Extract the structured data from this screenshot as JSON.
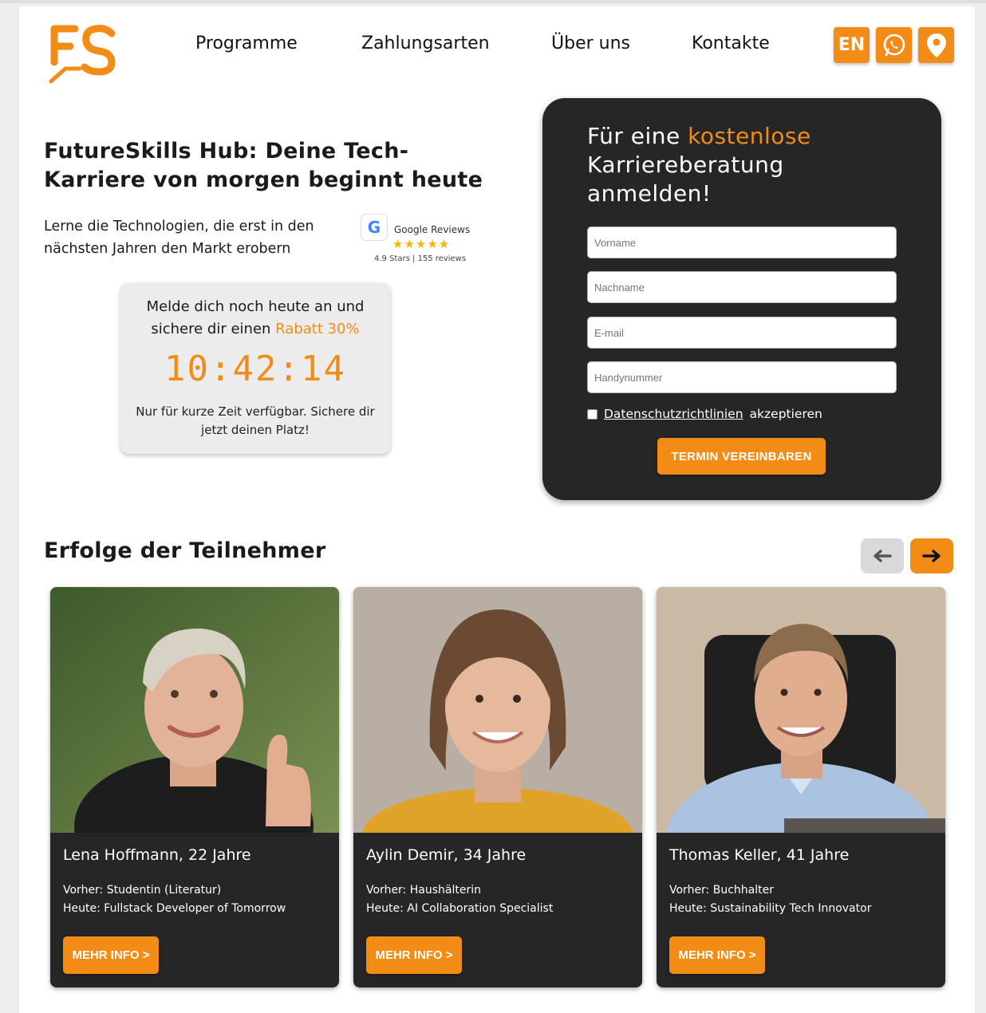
{
  "brand": {
    "logo_text": "FS",
    "accent": "#f28c16"
  },
  "nav": {
    "items": [
      {
        "label": "Programme"
      },
      {
        "label": "Zahlungsarten"
      },
      {
        "label": "Über uns"
      },
      {
        "label": "Kontakte"
      }
    ]
  },
  "header_buttons": {
    "language": "EN",
    "whatsapp_icon": "whatsapp-icon",
    "location_icon": "location-pin-icon"
  },
  "hero": {
    "title": "FutureSkills Hub: Deine Tech-Karriere von morgen beginnt heute",
    "subtitle": "Lerne die Technologien, die erst in den nächsten Jahren den Markt erobern"
  },
  "google_reviews": {
    "title": "Google Reviews",
    "stars": "★★★★★",
    "meta": "4.9 Stars | 155 reviews",
    "rating": 4.9
  },
  "promo": {
    "line1": "Melde dich noch heute an und",
    "line2_prefix": "sichere dir einen ",
    "line2_accent": "Rabatt 30%",
    "timer": "10:42:14",
    "note": "Nur für kurze Zeit verfügbar. Sichere dir jetzt deinen Platz!"
  },
  "form": {
    "title_prefix": "Für eine ",
    "title_accent": "kostenlose",
    "title_rest": " Karriereberatung anmelden!",
    "fields": {
      "firstname_placeholder": "Vorname",
      "lastname_placeholder": "Nachname",
      "email_placeholder": "E-mail",
      "phone_placeholder": "Handynummer"
    },
    "consent_link": "Datenschutzrichtlinien",
    "consent_rest": "akzeptieren",
    "submit_label": "TERMIN VEREINBAREN"
  },
  "success": {
    "title": "Erfolge der Teilnehmer",
    "prev_icon": "arrow-left-icon",
    "next_icon": "arrow-right-icon",
    "cards": [
      {
        "name": "Lena Hoffmann, 22 Jahre",
        "before": "Vorher: Studentin (Literatur)",
        "after": "Heute: Fullstack Developer of Tomorrow",
        "button": "MEHR INFO >"
      },
      {
        "name": "Aylin Demir, 34 Jahre",
        "before": "Vorher: Haushälterin",
        "after": "Heute: AI Collaboration Specialist",
        "button": "MEHR INFO >"
      },
      {
        "name": "Thomas Keller, 41 Jahre",
        "before": "Vorher: Buchhalter",
        "after": "Heute: Sustainability Tech Innovator",
        "button": "MEHR INFO >"
      }
    ]
  }
}
